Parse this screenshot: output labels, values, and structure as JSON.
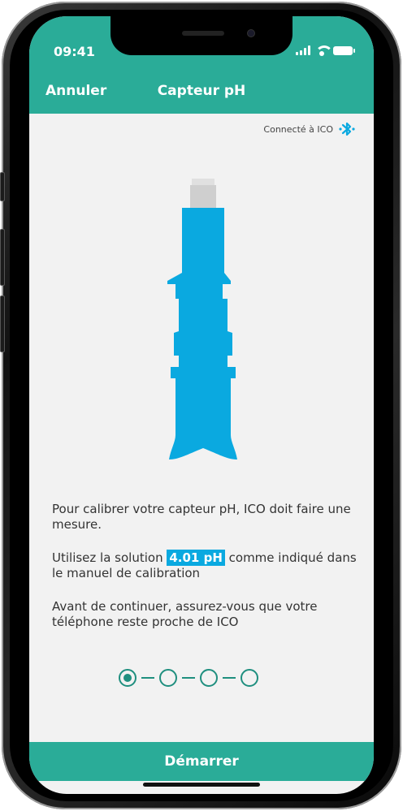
{
  "status_bar": {
    "time": "09:41"
  },
  "nav": {
    "cancel_label": "Annuler",
    "title": "Capteur pH"
  },
  "connection": {
    "text": "Connecté à ICO",
    "icon": "bluetooth-icon"
  },
  "instructions": {
    "line1": "Pour calibrer votre capteur pH, ICO doit faire une mesure.",
    "line2_before": "Utilisez la solution ",
    "line2_highlight": "4.01 pH",
    "line2_after": " comme indiqué dans le manuel de calibration",
    "line3": "Avant de continuer, assurez-vous que votre téléphone reste proche de ICO"
  },
  "stepper": {
    "total": 4,
    "current": 1
  },
  "start_label": "Démarrer",
  "colors": {
    "accent": "#2aac98",
    "sensor": "#0aa9e0",
    "sensor_cap": "#d0d0d0",
    "highlight": "#0aa9e0"
  }
}
